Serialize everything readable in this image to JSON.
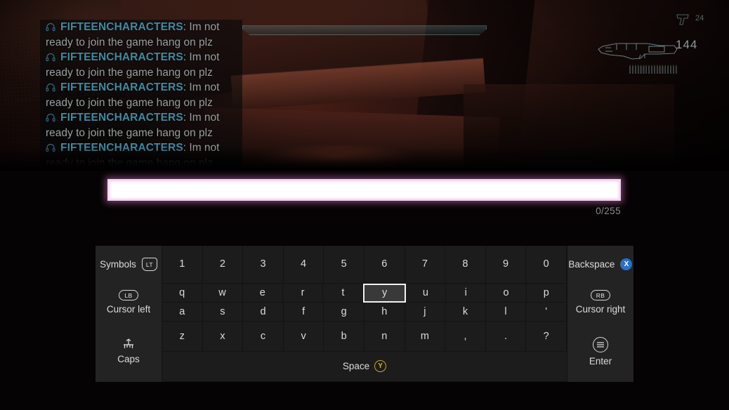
{
  "game": {
    "hud": {
      "ammo_primary": "144",
      "ammo_secondary": "24",
      "grenade_pip_count": 18
    },
    "chat": {
      "messages": [
        {
          "icon": "headset-icon",
          "username": "FIFTEENCHARACTERS",
          "separator": ":",
          "text": "Im not ready to join the game hang on plz"
        },
        {
          "icon": "headset-icon",
          "username": "FIFTEENCHARACTERS",
          "separator": ":",
          "text": "Im not ready to join the game hang on plz"
        },
        {
          "icon": "headset-icon",
          "username": "FIFTEENCHARACTERS",
          "separator": ":",
          "text": "Im not ready to join the game hang on plz"
        },
        {
          "icon": "headset-icon",
          "username": "FIFTEENCHARACTERS",
          "separator": ":",
          "text": "Im not ready to join the game hang on plz"
        },
        {
          "icon": "headset-icon",
          "username": "FIFTEENCHARACTERS",
          "separator": ":",
          "text": "Im not ready to join the game hang on plz"
        }
      ]
    }
  },
  "input": {
    "value": "",
    "placeholder": "",
    "char_count": "0/255",
    "border_glow_color": "#e278ce"
  },
  "keyboard": {
    "rows": [
      {
        "left": {
          "label": "Symbols",
          "badge": "LT",
          "badge_type": "trigger",
          "icon": "trigger-lt-icon",
          "layout": "inline"
        },
        "keys": [
          "1",
          "2",
          "3",
          "4",
          "5",
          "6",
          "7",
          "8",
          "9",
          "0"
        ],
        "right": {
          "label": "Backspace",
          "badge": "X",
          "badge_type": "button-x",
          "icon": "button-x-icon",
          "layout": "inline"
        }
      },
      {
        "left": {
          "label": "Cursor left",
          "badge": "LB",
          "badge_type": "bumper",
          "icon": "bumper-lb-icon",
          "layout": "stacked"
        },
        "keys": [
          "q",
          "w",
          "e",
          "r",
          "t",
          "y",
          "u",
          "i",
          "o",
          "p"
        ],
        "right": {
          "label": "Cursor right",
          "badge": "RB",
          "badge_type": "bumper",
          "icon": "bumper-rb-icon",
          "layout": "stacked"
        }
      },
      {
        "keys": [
          "a",
          "s",
          "d",
          "f",
          "g",
          "h",
          "j",
          "k",
          "l",
          "'"
        ]
      },
      {
        "left": {
          "label": "Caps",
          "badge": "",
          "badge_type": "caps",
          "icon": "caps-shift-icon",
          "layout": "stacked"
        },
        "keys": [
          "z",
          "x",
          "c",
          "v",
          "b",
          "n",
          "m",
          ",",
          ".",
          "?"
        ],
        "right": {
          "label": "Enter",
          "badge": "",
          "badge_type": "menu",
          "icon": "menu-button-icon",
          "layout": "stacked"
        }
      }
    ],
    "space": {
      "label": "Space",
      "badge": "Y",
      "badge_type": "button-y",
      "icon": "button-y-icon"
    },
    "selected_key": "y",
    "selected_key_color": "#f2f2f2"
  },
  "colors": {
    "keyboard_bg": "#1f1f1f",
    "key_bg": "#1c1c1c",
    "side_key_bg": "#232323",
    "key_text": "#dcdcdc",
    "username": "#3f8ba3",
    "chat_text": "#9aa0a1",
    "x_button": "#2d6fc4",
    "y_button": "#c9a227"
  }
}
